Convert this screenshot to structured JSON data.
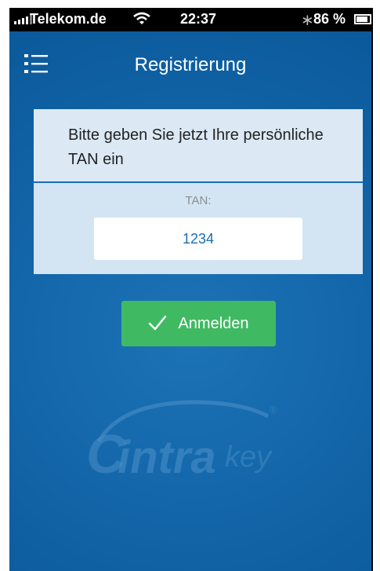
{
  "status_bar": {
    "carrier": "Telekom.de",
    "time": "22:37",
    "battery_percent": "86 %",
    "battery_level": 0.86,
    "icons": [
      "signal-icon",
      "wifi-icon",
      "bluetooth-icon",
      "battery-icon"
    ]
  },
  "nav": {
    "title": "Registrierung",
    "menu_icon": "list-menu-icon"
  },
  "form": {
    "prompt": "Bitte geben Sie jetzt Ihre persönliche TAN ein",
    "tan_label": "TAN:",
    "tan_value": "1234"
  },
  "actions": {
    "login_label": "Anmelden",
    "login_icon": "check-icon"
  },
  "brand": {
    "logo_text_primary": "intra",
    "logo_text_secondary": "key",
    "logo_mark": "®"
  },
  "colors": {
    "background": "#1265a8",
    "panel": "#dce9f5",
    "accent": "#1a6eb3",
    "button": "#3fba62"
  }
}
